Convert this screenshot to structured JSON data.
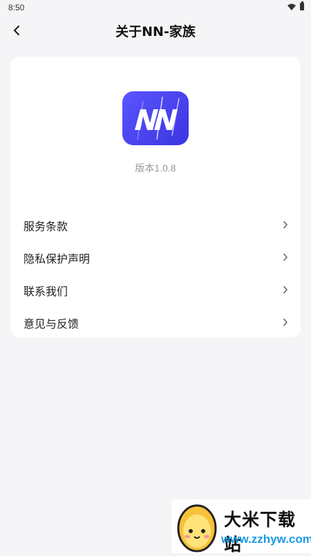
{
  "status_bar": {
    "time": "8:50"
  },
  "header": {
    "title": "关于NN-家族"
  },
  "app": {
    "logo_text": "NN",
    "version_label": "版本",
    "version_number": "1.0.8"
  },
  "menu": {
    "items": [
      {
        "label": "服务条款"
      },
      {
        "label": "隐私保护声明"
      },
      {
        "label": "联系我们"
      },
      {
        "label": "意见与反馈"
      }
    ]
  },
  "watermark": {
    "title": "大米下载站",
    "url": "www.zzhyw.com"
  },
  "colors": {
    "accent": "#4a45f2",
    "background": "#f5f5f7",
    "card": "#ffffff"
  }
}
